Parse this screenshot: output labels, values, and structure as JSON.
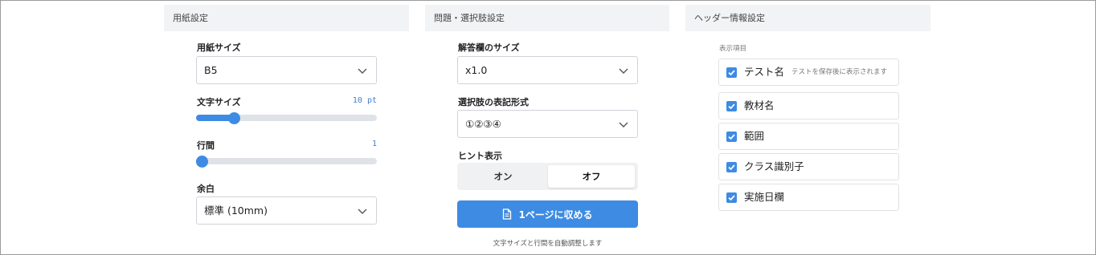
{
  "paper_section": {
    "header": "用紙設定",
    "paper_size": {
      "label": "用紙サイズ",
      "value": "B5"
    },
    "font_size": {
      "label": "文字サイズ",
      "value_text": "10 pt",
      "level": 0.19
    },
    "line_spacing": {
      "label": "行間",
      "value_text": "1",
      "level": 0.0
    },
    "margin": {
      "label": "余白",
      "value": "標準 (10mm)"
    }
  },
  "question_section": {
    "header": "問題・選択肢設定",
    "answer_size": {
      "label": "解答欄のサイズ",
      "value": "x1.0"
    },
    "choice_format": {
      "label": "選択肢の表記形式",
      "value": "①②③④"
    },
    "hint": {
      "label": "ヒント表示",
      "on_label": "オン",
      "off_label": "オフ",
      "selected": "オフ"
    },
    "fit_button": {
      "label": "1ページに収める",
      "icon": "document-icon"
    },
    "fit_note": "文字サイズと行間を自動調整します"
  },
  "header_section": {
    "header": "ヘッダー情報設定",
    "items_label": "表示項目",
    "items": [
      {
        "label": "テスト名",
        "checked": true,
        "hint": "テストを保存後に表示されます"
      },
      {
        "label": "教材名",
        "checked": true
      },
      {
        "label": "範囲",
        "checked": true
      },
      {
        "label": "クラス識別子",
        "checked": true
      },
      {
        "label": "実施日欄",
        "checked": true
      }
    ]
  },
  "colors": {
    "accent": "#3d8be3",
    "track": "#dfe3e8",
    "section_bg": "#f2f3f5"
  }
}
